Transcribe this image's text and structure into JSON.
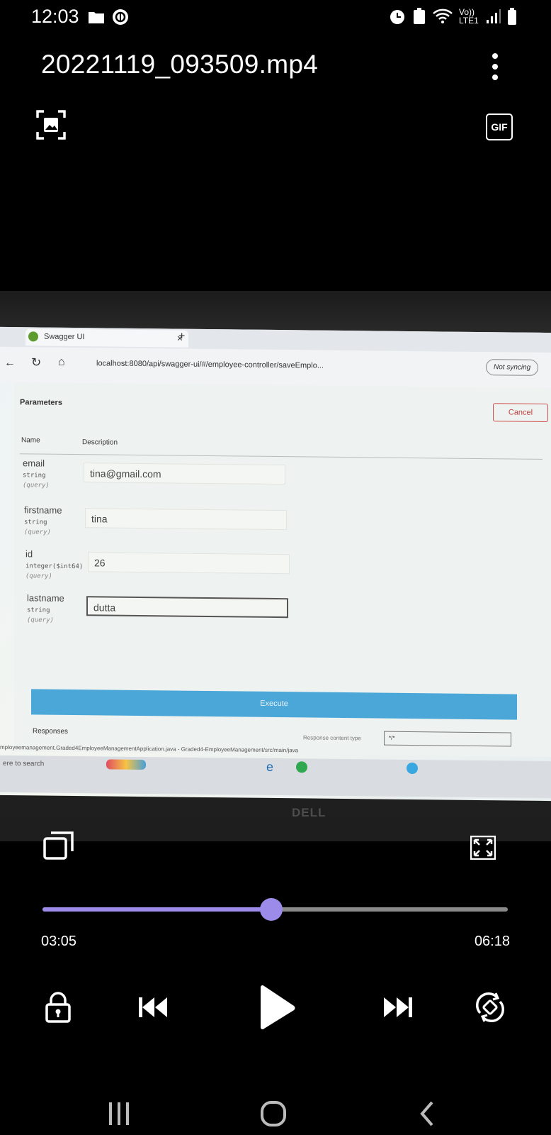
{
  "status_bar": {
    "time": "12:03",
    "network_label": "Vo)) LTE1"
  },
  "player": {
    "title": "20221119_093509.mp4",
    "gif_label": "GIF",
    "current_time": "03:05",
    "total_time": "06:18",
    "progress": 0.492,
    "accent_color": "#9c8be8"
  },
  "video_content": {
    "browser_tab": "Swagger UI",
    "url": "localhost:8080/api/swagger-ui/#/employee-controller/saveEmplo...",
    "sync_label": "Not syncing",
    "section_title": "Parameters",
    "cancel_label": "Cancel",
    "col_name": "Name",
    "col_description": "Description",
    "params": [
      {
        "name": "email",
        "type": "string",
        "in": "(query)",
        "value": "tina@gmail.com"
      },
      {
        "name": "firstname",
        "type": "string",
        "in": "(query)",
        "value": "tina"
      },
      {
        "name": "id",
        "type": "integer($int64)",
        "in": "(query)",
        "value": "26"
      },
      {
        "name": "lastname",
        "type": "string",
        "in": "(query)",
        "value": "dutta"
      }
    ],
    "execute_label": "Execute",
    "responses_label": "Responses",
    "response_content_type_label": "Response content type",
    "response_content_type_value": "*/*",
    "status_path": "mployeemanagement.Graded4EmployeeManagementApplication.java - Graded4-EmployeeManagement/src/main/java",
    "search_label": "ere to search",
    "laptop_brand": "DELL"
  },
  "icons": {
    "gallery": "gallery-icon",
    "more": "more-vertical-icon",
    "pip": "popup-play-icon",
    "fullscreen": "fullscreen-icon",
    "lock": "lock-icon",
    "prev": "skip-previous-icon",
    "play": "play-icon",
    "next": "skip-next-icon",
    "rotate": "rotate-icon"
  }
}
